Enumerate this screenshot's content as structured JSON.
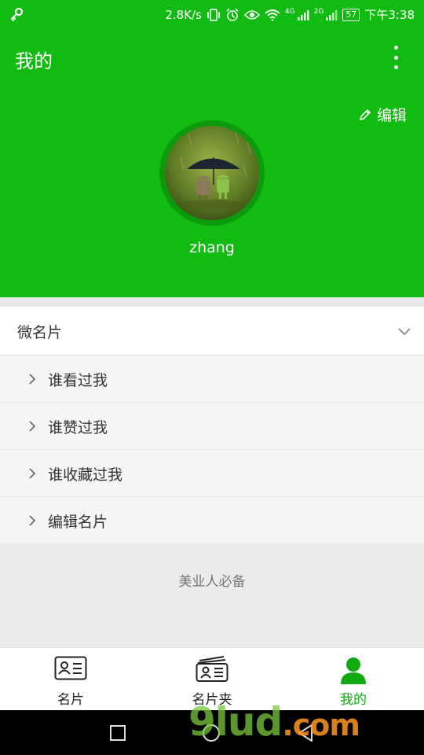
{
  "status": {
    "speed": "2.8K/s",
    "network_1": "4G",
    "network_2": "2G",
    "battery": "57",
    "time": "下午3:38"
  },
  "header": {
    "title": "我的",
    "edit_label": "编辑",
    "username": "zhang"
  },
  "section": {
    "title": "微名片",
    "items": [
      {
        "label": "谁看过我"
      },
      {
        "label": "谁赞过我"
      },
      {
        "label": "谁收藏过我"
      },
      {
        "label": "编辑名片"
      }
    ]
  },
  "slogan": "美业人必备",
  "tabs": [
    {
      "label": "名片",
      "icon": "id-card-icon",
      "active": false
    },
    {
      "label": "名片夹",
      "icon": "card-holder-icon",
      "active": false
    },
    {
      "label": "我的",
      "icon": "person-icon",
      "active": true
    }
  ],
  "watermark": {
    "main": "9lud",
    "suffix": ".com"
  },
  "colors": {
    "brand_green": "#11bb11",
    "active_tab": "#11aa11"
  }
}
